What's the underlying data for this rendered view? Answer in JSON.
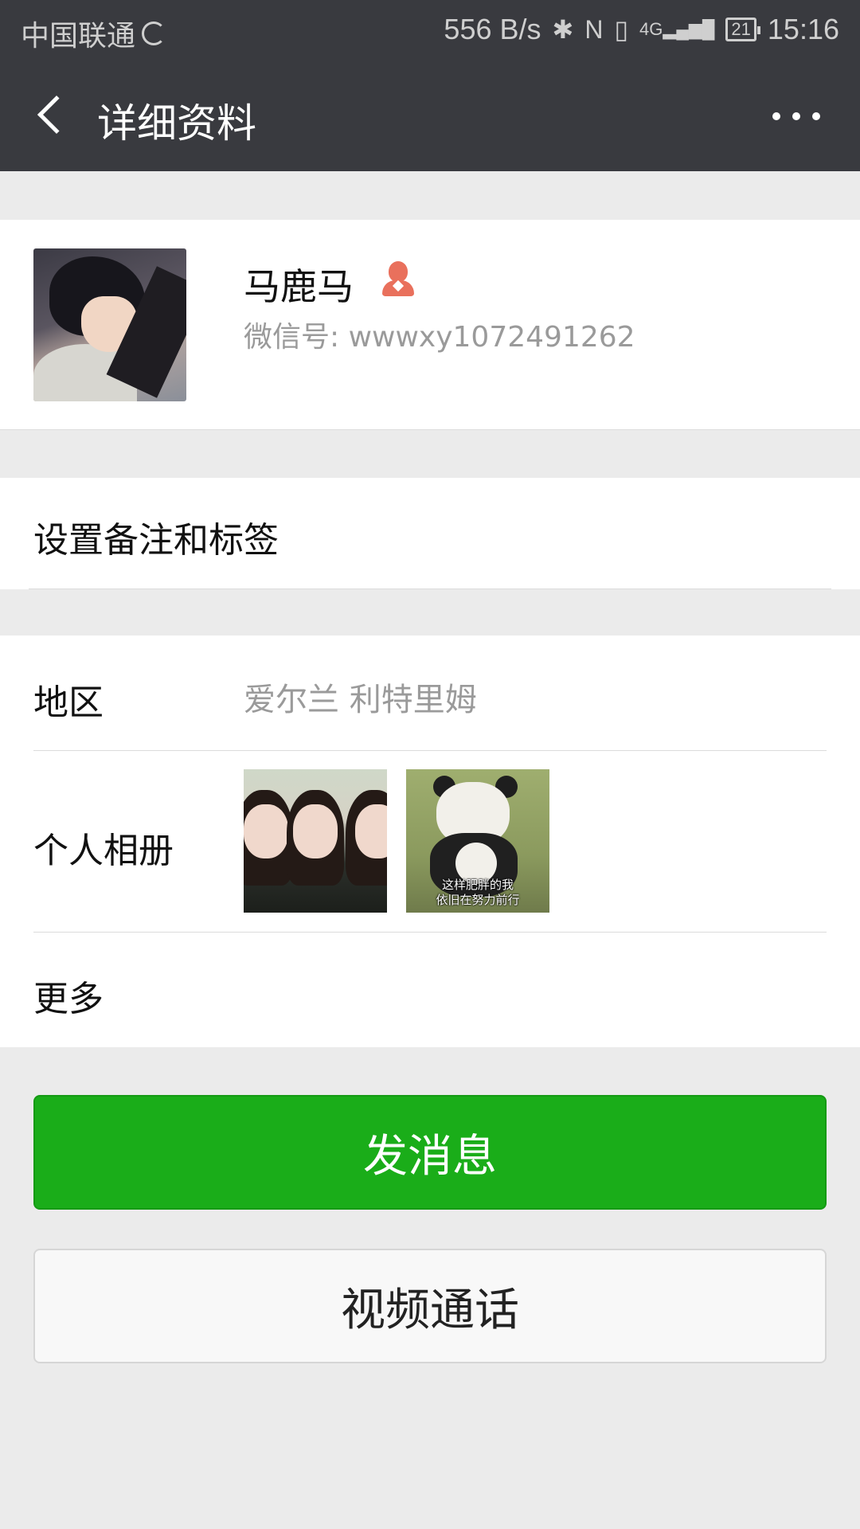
{
  "status_bar": {
    "carrier": "中国联通",
    "network_speed": "556 B/s",
    "signal_label": "4G",
    "battery": "21",
    "time": "15:16"
  },
  "nav": {
    "title": "详细资料"
  },
  "profile": {
    "name": "马鹿马",
    "wechat_id": "微信号: wwwxy1072491262",
    "gender": "female",
    "gender_icon_color": "#e9705c"
  },
  "remark": {
    "label": "设置备注和标签"
  },
  "details": {
    "region_label": "地区",
    "region_value": "爱尔兰  利特里姆",
    "album_label": "个人相册",
    "album_caption_line1": "这样肥胖的我",
    "album_caption_line2": "依旧在努力前行",
    "more_label": "更多"
  },
  "actions": {
    "send_message": "发消息",
    "video_call": "视频通话",
    "accent_color": "#1aad19"
  }
}
